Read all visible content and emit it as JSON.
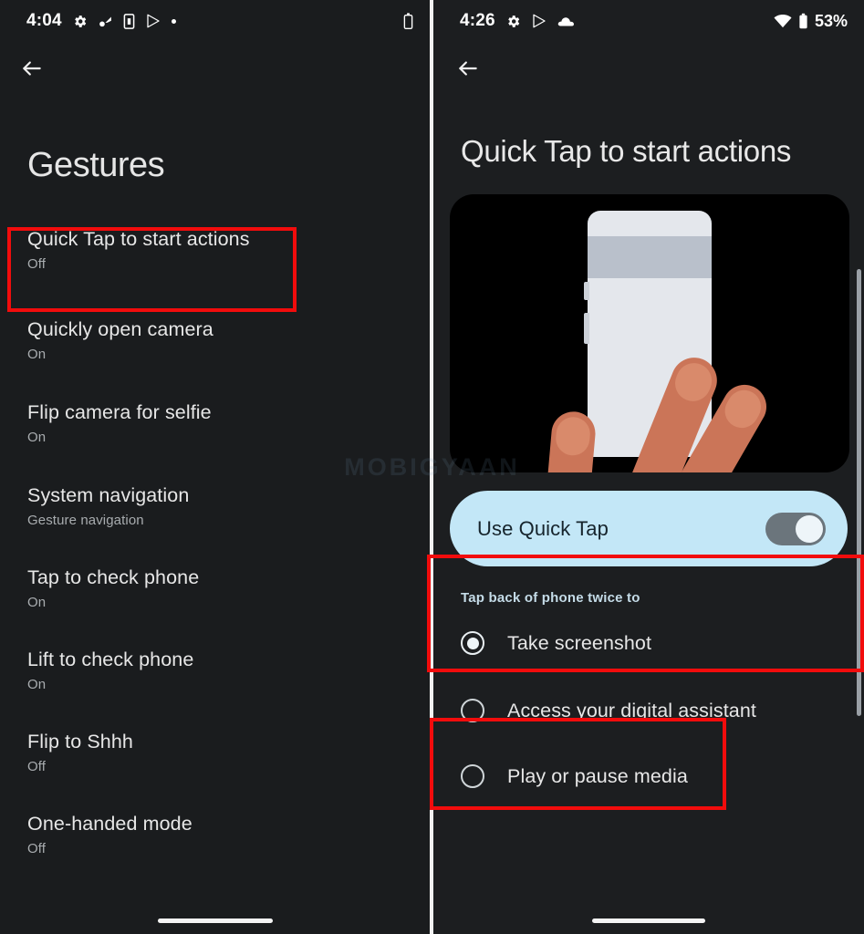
{
  "left": {
    "statusbar": {
      "time": "4:04",
      "icons": [
        "gear-icon",
        "settings-sync-icon",
        "phone-app-icon",
        "play-store-icon",
        "dot-icon"
      ],
      "right_icons": [
        "battery-icon"
      ]
    },
    "back_label": "Back",
    "title": "Gestures",
    "items": [
      {
        "title": "Quick Tap to start actions",
        "sub": "Off",
        "highlighted": true
      },
      {
        "title": "Quickly open camera",
        "sub": "On",
        "highlighted": false
      },
      {
        "title": "Flip camera for selfie",
        "sub": "On",
        "highlighted": false
      },
      {
        "title": "System navigation",
        "sub": "Gesture navigation",
        "highlighted": false
      },
      {
        "title": "Tap to check phone",
        "sub": "On",
        "highlighted": false
      },
      {
        "title": "Lift to check phone",
        "sub": "On",
        "highlighted": false
      },
      {
        "title": "Flip to Shhh",
        "sub": "Off",
        "highlighted": false
      },
      {
        "title": "One-handed mode",
        "sub": "Off",
        "highlighted": false
      }
    ]
  },
  "right": {
    "statusbar": {
      "time": "4:26",
      "icons": [
        "gear-icon",
        "play-store-icon",
        "cloud-icon"
      ],
      "right_icons": [
        "wifi-icon",
        "battery-icon"
      ],
      "battery_percent": "53%"
    },
    "back_label": "Back",
    "title": "Quick Tap to start actions",
    "illustration_alt": "hand tapping back of phone twice",
    "toggle": {
      "label": "Use Quick Tap",
      "state": "on"
    },
    "section_label": "Tap back of phone twice to",
    "options": [
      {
        "label": "Take screenshot",
        "selected": true,
        "highlighted": true
      },
      {
        "label": "Access your digital assistant",
        "selected": false,
        "highlighted": false
      },
      {
        "label": "Play or pause media",
        "selected": false,
        "highlighted": false
      }
    ]
  },
  "watermark": "MOBIGYAAN",
  "colors": {
    "background": "#1a1c1e",
    "highlight_red": "#f20c0c",
    "toggle_card": "#c3e7f7",
    "accent_text": "#c5dce8"
  }
}
